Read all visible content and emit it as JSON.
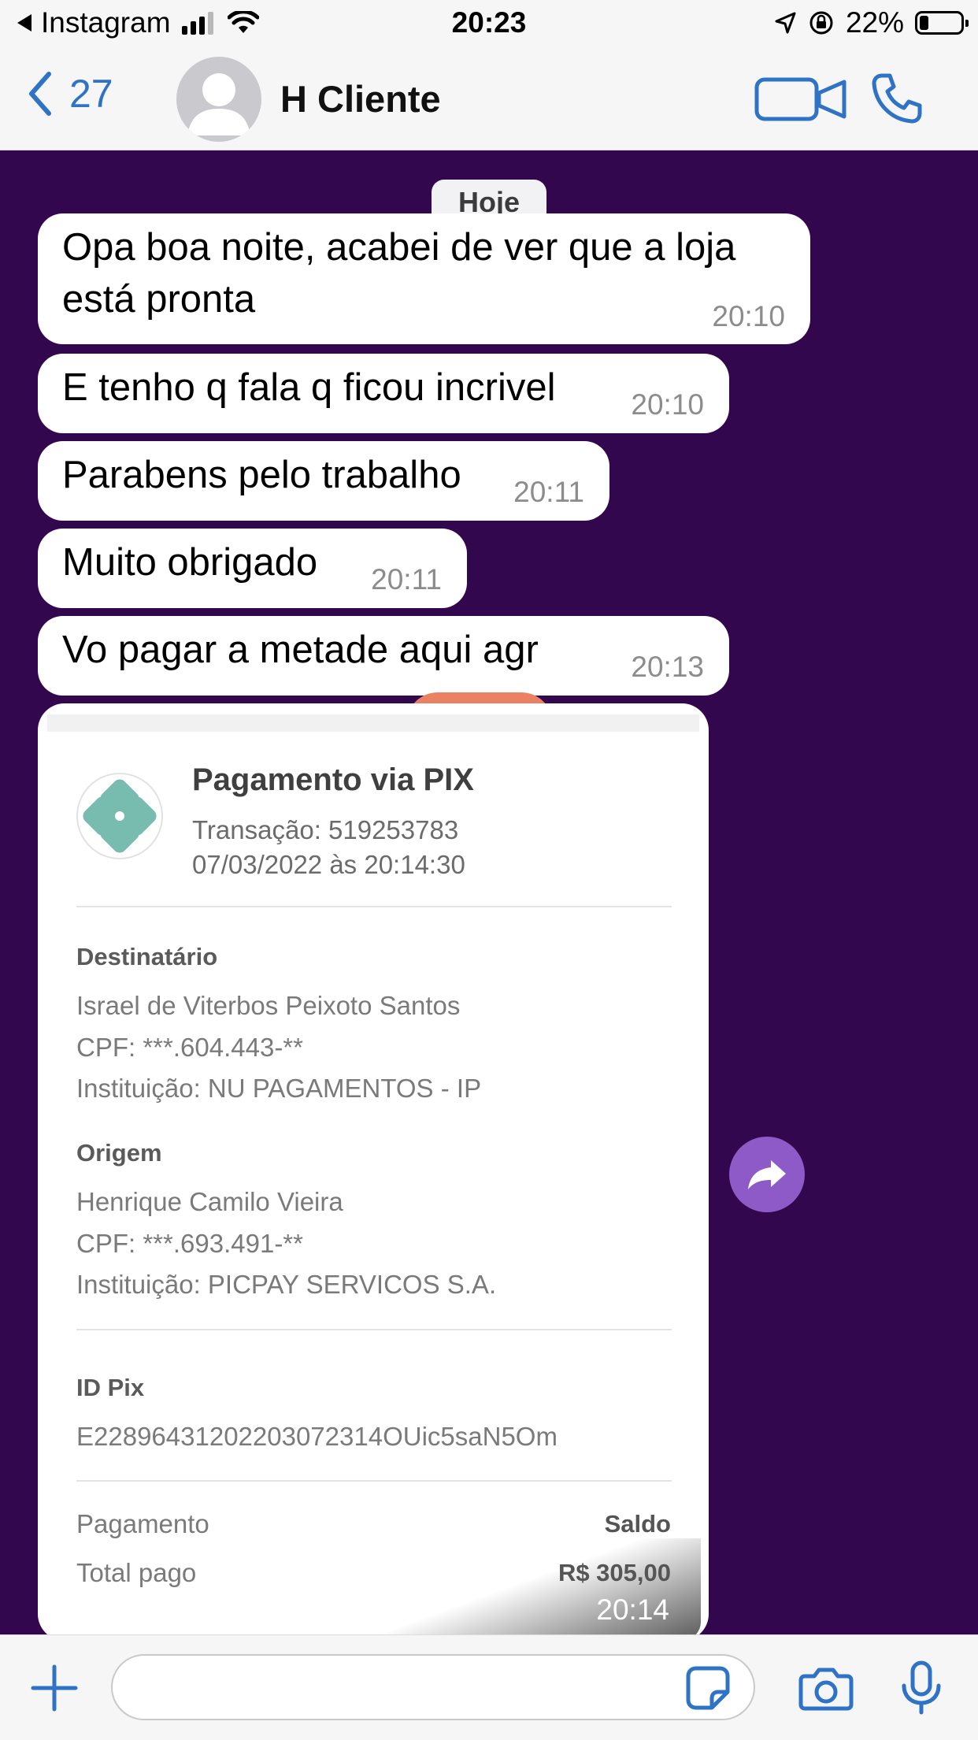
{
  "status_bar": {
    "back_app": "Instagram",
    "time": "20:23",
    "battery": "22%",
    "icons": [
      "signal-icon",
      "wifi-icon",
      "location-arrow-icon",
      "orientation-lock-icon",
      "battery-icon"
    ]
  },
  "header": {
    "back_count": "27",
    "contact_name": "H Cliente",
    "icons": [
      "back-chevron-icon",
      "avatar-placeholder-icon",
      "video-camera-icon",
      "phone-icon"
    ]
  },
  "colors": {
    "chat_background": "#33074d",
    "ios_blue": "#2f73c6",
    "bubble": "#ffffff",
    "share_button": "#8e5ac8",
    "pix_teal": "#77bcae"
  },
  "chat": {
    "date_label": "Hoje",
    "messages": [
      {
        "lines": [
          "Opa boa noite, acabei de ver que a loja",
          "está pronta"
        ],
        "time": "20:10"
      },
      {
        "lines": [
          "E tenho q fala q ficou incrivel"
        ],
        "time": "20:10"
      },
      {
        "lines": [
          "Parabens pelo trabalho"
        ],
        "time": "20:11"
      },
      {
        "lines": [
          "Muito obrigado"
        ],
        "time": "20:11"
      },
      {
        "lines": [
          "Vo pagar a metade aqui agr"
        ],
        "time": "20:13"
      }
    ],
    "receipt": {
      "title": "Pagamento via PIX",
      "transaction": "Transação: 519253783",
      "datetime": "07/03/2022 às 20:14:30",
      "recipient_label": "Destinatário",
      "recipient_name": "Israel de Viterbos Peixoto Santos",
      "recipient_cpf": "CPF: ***.604.443-**",
      "recipient_institution": "Instituição: NU PAGAMENTOS - IP",
      "origin_label": "Origem",
      "origin_name": "Henrique Camilo Vieira",
      "origin_cpf": "CPF: ***.693.491-**",
      "origin_institution": "Instituição: PICPAY SERVICOS S.A.",
      "id_label": "ID Pix",
      "id_value": "E22896431202203072314OUic5saN5Om",
      "payment_label": "Pagamento",
      "payment_value": "Saldo",
      "total_label": "Total pago",
      "total_value": "R$ 305,00",
      "time": "20:14"
    },
    "icons": [
      "pix-logo-icon",
      "share-arrow-icon"
    ]
  },
  "composer": {
    "placeholder": "",
    "icons": [
      "plus-icon",
      "sticker-icon",
      "camera-icon",
      "microphone-icon"
    ]
  }
}
